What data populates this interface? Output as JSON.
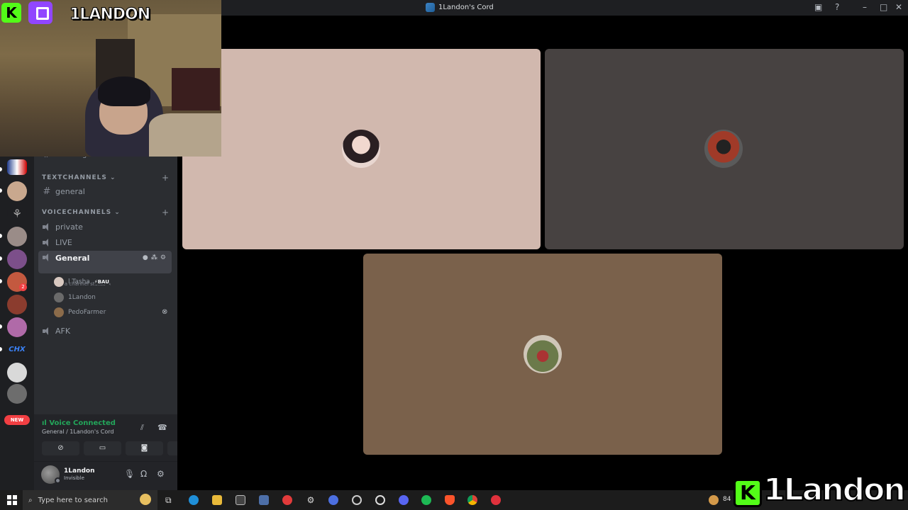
{
  "window": {
    "title": "1Landon's Cord"
  },
  "overlay": {
    "cam_name": "1LANDON",
    "kick_letter": "K",
    "bottom_brand": "1Landon"
  },
  "channels": {
    "partial_channel": "audit-log",
    "text_category": "TEXTCHANNELS",
    "voice_category": "VOICECHANNELS",
    "text_channels": [
      "general"
    ],
    "voice_channels": [
      "private",
      "LIVE",
      "General",
      "AFK"
    ],
    "status_placeholder": "Set a channel status",
    "voice_users": [
      {
        "name": "l Tasha",
        "tag": "BAU"
      },
      {
        "name": "1Landon",
        "tag": ""
      },
      {
        "name": "PedoFarmer",
        "tag": ""
      }
    ]
  },
  "guilds": {
    "chx_label": "CHX",
    "new_badge": "NEW",
    "mention_count": "2"
  },
  "voice_panel": {
    "status": "Voice Connected",
    "location": "General / 1Landon's Cord"
  },
  "user": {
    "name": "1Landon",
    "status": "Invisible"
  },
  "taskbar": {
    "search_placeholder": "Type here to search",
    "tray_partial": "84"
  },
  "colors": {
    "tile1": "#d1b8ae",
    "tile2": "#474241",
    "tile3": "#7a614b",
    "connected": "#23a55a",
    "kick": "#53fc18",
    "twitch": "#9146ff"
  }
}
